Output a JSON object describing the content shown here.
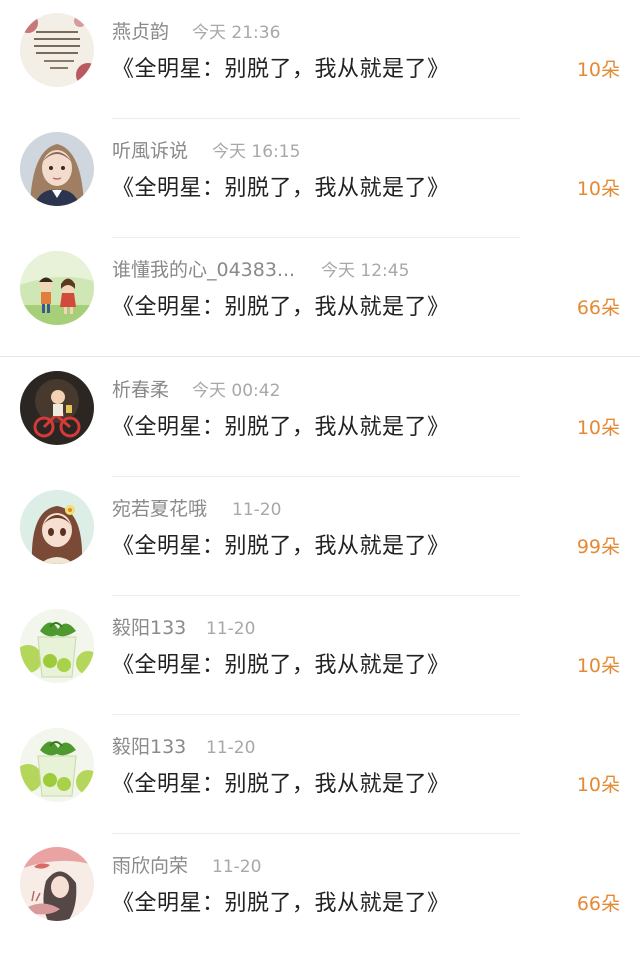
{
  "items": [
    {
      "name": "燕贞韵",
      "time": "今天 21:36",
      "gift": "《全明星：别脱了，我从就是了》",
      "count": "10朵",
      "avatar": "avatar-poem"
    },
    {
      "name": "听風诉说",
      "time": "今天 16:15",
      "gift": "《全明星：别脱了，我从就是了》",
      "count": "10朵",
      "avatar": "avatar-girl-portrait"
    },
    {
      "name": "谁懂我的心_04383...",
      "time": "今天 12:45",
      "gift": "《全明星：别脱了，我从就是了》",
      "count": "66朵",
      "avatar": "avatar-cartoon-kids"
    },
    {
      "name": "析春柔",
      "time": "今天 00:42",
      "gift": "《全明星：别脱了，我从就是了》",
      "count": "10朵",
      "avatar": "avatar-bicycle"
    },
    {
      "name": "宛若夏花哦",
      "time": "11-20",
      "gift": "《全明星：别脱了，我从就是了》",
      "count": "99朵",
      "avatar": "avatar-anime-girl"
    },
    {
      "name": "毅阳133",
      "time": "11-20",
      "gift": "《全明星：别脱了，我从就是了》",
      "count": "10朵",
      "avatar": "avatar-mojito"
    },
    {
      "name": "毅阳133",
      "time": "11-20",
      "gift": "《全明星：别脱了，我从就是了》",
      "count": "10朵",
      "avatar": "avatar-mojito"
    },
    {
      "name": "雨欣向荣",
      "time": "11-20",
      "gift": "《全明星：别脱了，我从就是了》",
      "count": "66朵",
      "avatar": "avatar-lady-illustration"
    }
  ]
}
